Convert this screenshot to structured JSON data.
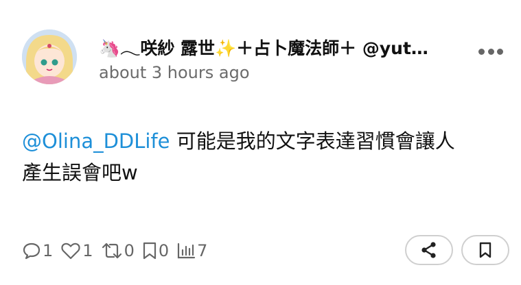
{
  "post": {
    "display_name": "🦄𓂃咲紗 露世✨＋占卜魔法師＋ @yut…",
    "timestamp": "about 3 hours ago",
    "mention": "@Olina_DDLife",
    "text_line1": " 可能是我的文字表達習慣會讓人",
    "text_line2": "產生誤會吧w"
  },
  "actions": {
    "replies": "1",
    "likes": "1",
    "boosts": "0",
    "bookmarks": "0",
    "views": "7"
  },
  "icons": {
    "more": "more-horizontal-icon",
    "reply": "reply-icon",
    "like": "heart-icon",
    "boost": "repost-icon",
    "bookmark": "bookmark-icon",
    "views": "stats-icon",
    "share": "share-icon",
    "save": "bookmark-icon"
  }
}
